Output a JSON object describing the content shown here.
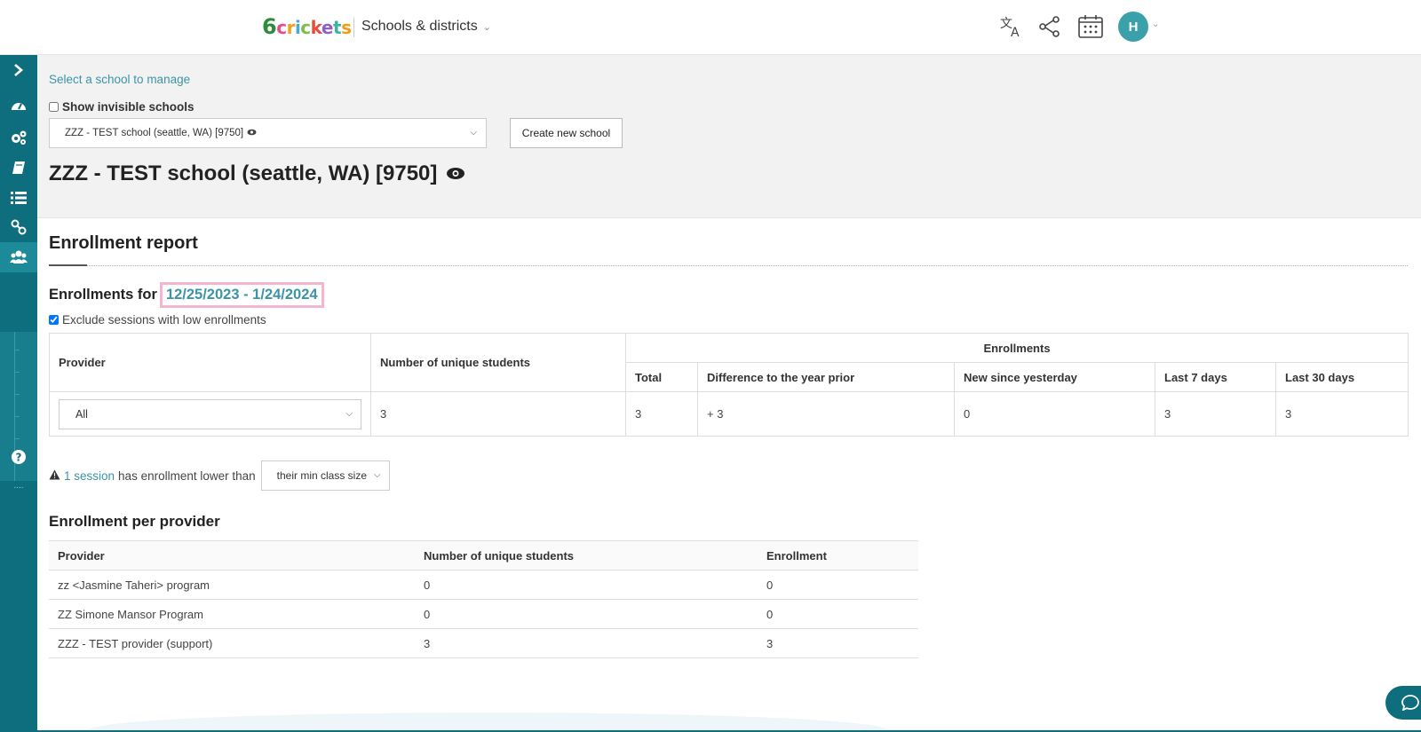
{
  "header": {
    "logo_parts": [
      "6",
      "c",
      "r",
      "i",
      "c",
      "k",
      "e",
      "t",
      "s"
    ],
    "nav_title": "Schools & districts",
    "avatar_initial": "H",
    "icons": [
      "translate-icon",
      "share-icon",
      "calendar-icon"
    ]
  },
  "sidebar": {
    "items": [
      "expand-icon",
      "dashboard-icon",
      "settings-icon",
      "book-icon",
      "list-icon",
      "link-icon",
      "users-icon",
      "help-icon"
    ],
    "separator": "...."
  },
  "school_manager": {
    "select_link": "Select a school to manage",
    "show_invisible_label": "Show invisible schools",
    "show_invisible_checked": false,
    "selected_school": "ZZZ - TEST school (seattle, WA) [9750]",
    "create_button": "Create new school",
    "school_title": "ZZZ - TEST school (seattle, WA) [9750]"
  },
  "report": {
    "title": "Enrollment report",
    "enrollments_for_label": "Enrollments for",
    "date_range": "12/25/2023 - 1/24/2024",
    "exclude_label": "Exclude sessions with low enrollments",
    "exclude_checked": true,
    "table": {
      "provider_header": "Provider",
      "unique_header": "Number of unique students",
      "enrollments_header": "Enrollments",
      "sub_headers": [
        "Total",
        "Difference to the year prior",
        "New since yesterday",
        "Last 7 days",
        "Last 30 days"
      ],
      "provider_value": "All",
      "unique_value": "3",
      "values": [
        "3",
        "+ 3",
        "0",
        "3",
        "3"
      ]
    },
    "warning": {
      "link": "1 session",
      "text": "has enrollment lower than",
      "select_value": "their min class size"
    }
  },
  "per_provider": {
    "title": "Enrollment per provider",
    "headers": [
      "Provider",
      "Number of unique students",
      "Enrollment"
    ],
    "rows": [
      [
        "zz <Jasmine Taheri> program",
        "0",
        "0"
      ],
      [
        "ZZ Simone Mansor Program",
        "0",
        "0"
      ],
      [
        "ZZZ - TEST provider (support)",
        "3",
        "3"
      ]
    ]
  },
  "colors": {
    "sidebar": "#0e6e7e",
    "link": "#3b94a8",
    "date_highlight_border": "#f3b5cf",
    "avatar": "#3aa0aa"
  }
}
